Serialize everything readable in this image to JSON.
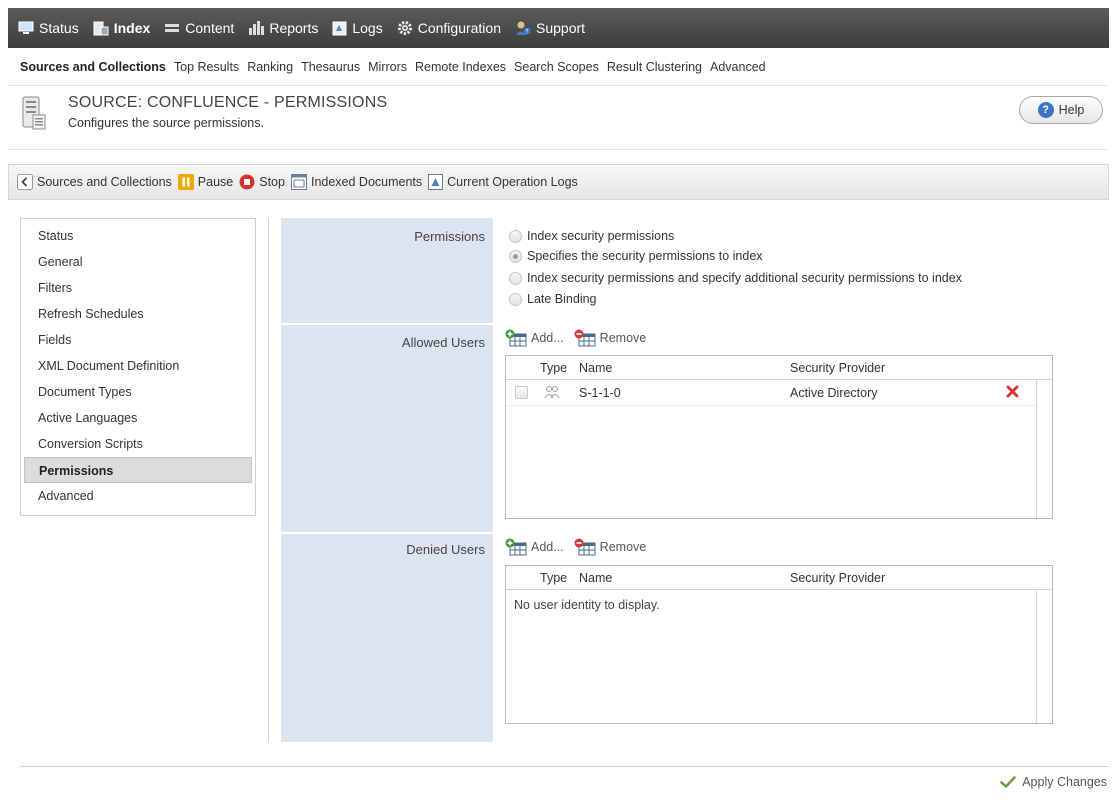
{
  "colors": {
    "nav_bg": "#4a4a4a",
    "label_col_bg": "#dde4f1",
    "accent": "#3f74c4",
    "remove_red": "#d23a3a"
  },
  "topnav": [
    {
      "label": "Status",
      "icon": "monitor-icon"
    },
    {
      "label": "Index",
      "icon": "index-icon",
      "active": true
    },
    {
      "label": "Content",
      "icon": "content-icon"
    },
    {
      "label": "Reports",
      "icon": "bar-chart-icon"
    },
    {
      "label": "Logs",
      "icon": "logs-icon"
    },
    {
      "label": "Configuration",
      "icon": "gear-icon"
    },
    {
      "label": "Support",
      "icon": "support-icon"
    }
  ],
  "subnav": [
    "Sources and Collections",
    "Top Results",
    "Ranking",
    "Thesaurus",
    "Mirrors",
    "Remote Indexes",
    "Search Scopes",
    "Result Clustering",
    "Advanced"
  ],
  "header": {
    "title": "SOURCE: CONFLUENCE - PERMISSIONS",
    "subtitle": "Configures the source permissions.",
    "help_label": "Help"
  },
  "toolbar": {
    "back_label": "Sources and Collections",
    "pause_label": "Pause",
    "stop_label": "Stop",
    "indexed_docs_label": "Indexed Documents",
    "logs_label": "Current Operation Logs"
  },
  "leftmenu": [
    "Status",
    "General",
    "Filters",
    "Refresh Schedules",
    "Fields",
    "XML Document Definition",
    "Document Types",
    "Active Languages",
    "Conversion Scripts",
    "Permissions",
    "Advanced"
  ],
  "permissions": {
    "label": "Permissions",
    "options": [
      "Index security permissions",
      "Specifies the security permissions to index",
      "Index security permissions and specify additional security permissions to index",
      "Late Binding"
    ],
    "selected_index": 1
  },
  "allowed": {
    "label": "Allowed Users",
    "add_label": "Add...",
    "remove_label": "Remove",
    "headers": {
      "type": "Type",
      "name": "Name",
      "provider": "Security Provider"
    },
    "rows": [
      {
        "name": "S-1-1-0",
        "provider": "Active Directory"
      }
    ]
  },
  "denied": {
    "label": "Denied Users",
    "add_label": "Add...",
    "remove_label": "Remove",
    "headers": {
      "type": "Type",
      "name": "Name",
      "provider": "Security Provider"
    },
    "empty_text": "No user identity to display."
  },
  "footer": {
    "apply_label": "Apply Changes"
  }
}
